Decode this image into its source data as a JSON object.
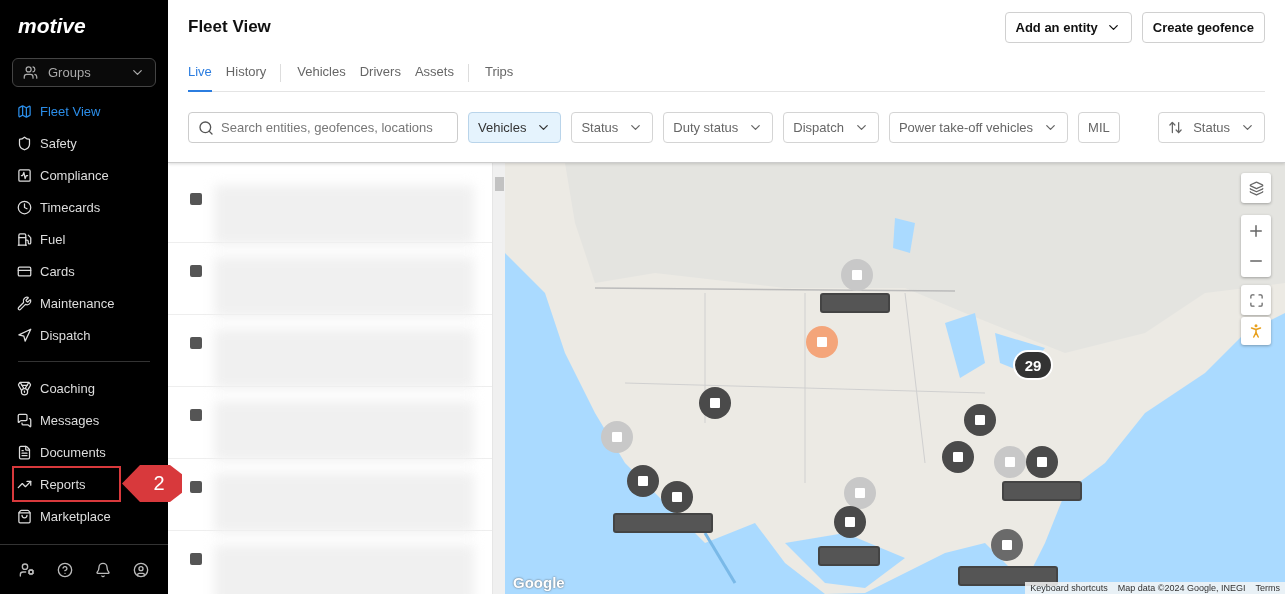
{
  "sidebar": {
    "logo": "motive",
    "groups": {
      "label": "Groups"
    },
    "sections": [
      [
        {
          "label": "Fleet View",
          "selected": true,
          "highlighted": false
        },
        {
          "label": "Safety",
          "selected": false,
          "highlighted": false
        },
        {
          "label": "Compliance",
          "selected": false,
          "highlighted": false
        },
        {
          "label": "Timecards",
          "selected": false,
          "highlighted": false
        },
        {
          "label": "Fuel",
          "selected": false,
          "highlighted": false
        },
        {
          "label": "Cards",
          "selected": false,
          "highlighted": false
        },
        {
          "label": "Maintenance",
          "selected": false,
          "highlighted": false
        },
        {
          "label": "Dispatch",
          "selected": false,
          "highlighted": false
        }
      ],
      [
        {
          "label": "Coaching",
          "selected": false,
          "highlighted": false
        },
        {
          "label": "Messages",
          "selected": false,
          "highlighted": false
        },
        {
          "label": "Documents",
          "selected": false,
          "highlighted": false
        },
        {
          "label": "Reports",
          "selected": false,
          "highlighted": true
        },
        {
          "label": "Marketplace",
          "selected": false,
          "highlighted": false
        }
      ]
    ]
  },
  "callout": {
    "number": "2"
  },
  "header": {
    "title": "Fleet View",
    "buttons": [
      {
        "label": "Add an entity",
        "dropdown": true
      },
      {
        "label": "Create geofence",
        "dropdown": false
      }
    ]
  },
  "tab_groups": [
    [
      {
        "label": "Live",
        "selected": true
      },
      {
        "label": "History",
        "selected": false
      }
    ],
    [
      {
        "label": "Vehicles",
        "selected": false
      },
      {
        "label": "Drivers",
        "selected": false
      },
      {
        "label": "Assets",
        "selected": false
      }
    ],
    [
      {
        "label": "Trips",
        "selected": false
      }
    ]
  ],
  "search": {
    "placeholder": "Search entities, geofences, locations"
  },
  "filters": [
    {
      "label": "Vehicles",
      "selected": true,
      "dropdown": true
    },
    {
      "label": "Status",
      "selected": false,
      "dropdown": true
    },
    {
      "label": "Duty status",
      "selected": false,
      "dropdown": true
    },
    {
      "label": "Dispatch",
      "selected": false,
      "dropdown": true
    },
    {
      "label": "Power take-off vehicles",
      "selected": false,
      "dropdown": true
    },
    {
      "label": "MIL",
      "selected": false,
      "dropdown": false
    }
  ],
  "sort": {
    "label": "Status"
  },
  "list": {
    "rows": [
      {
        "kind": "blurred"
      },
      {
        "kind": "blurred"
      },
      {
        "kind": "blurred"
      },
      {
        "kind": "blurred"
      },
      {
        "kind": "blurred"
      },
      {
        "kind": "blurred"
      }
    ]
  },
  "map": {
    "markers": [
      {
        "color": "#c8c8c8"
      },
      {
        "color": "#f4a57a"
      },
      {
        "color": "#4a4a4a"
      },
      {
        "color": "#c8c8c8"
      },
      {
        "color": "#4a4a4a"
      },
      {
        "color": "#4a4a4a"
      },
      {
        "color": "#c8c8c8"
      },
      {
        "color": "#4a4a4a"
      },
      {
        "color": "#4a4a4a"
      },
      {
        "color": "#4a4a4a"
      },
      {
        "color": "#c8c8c8"
      },
      {
        "color": "#4a4a4a"
      },
      {
        "color": "#6a6a6a"
      }
    ],
    "cluster": {
      "count": "29"
    },
    "logo": "Google",
    "attribution": [
      "Keyboard shortcuts",
      "Map data ©2024 Google, INEGI",
      "Terms"
    ]
  }
}
